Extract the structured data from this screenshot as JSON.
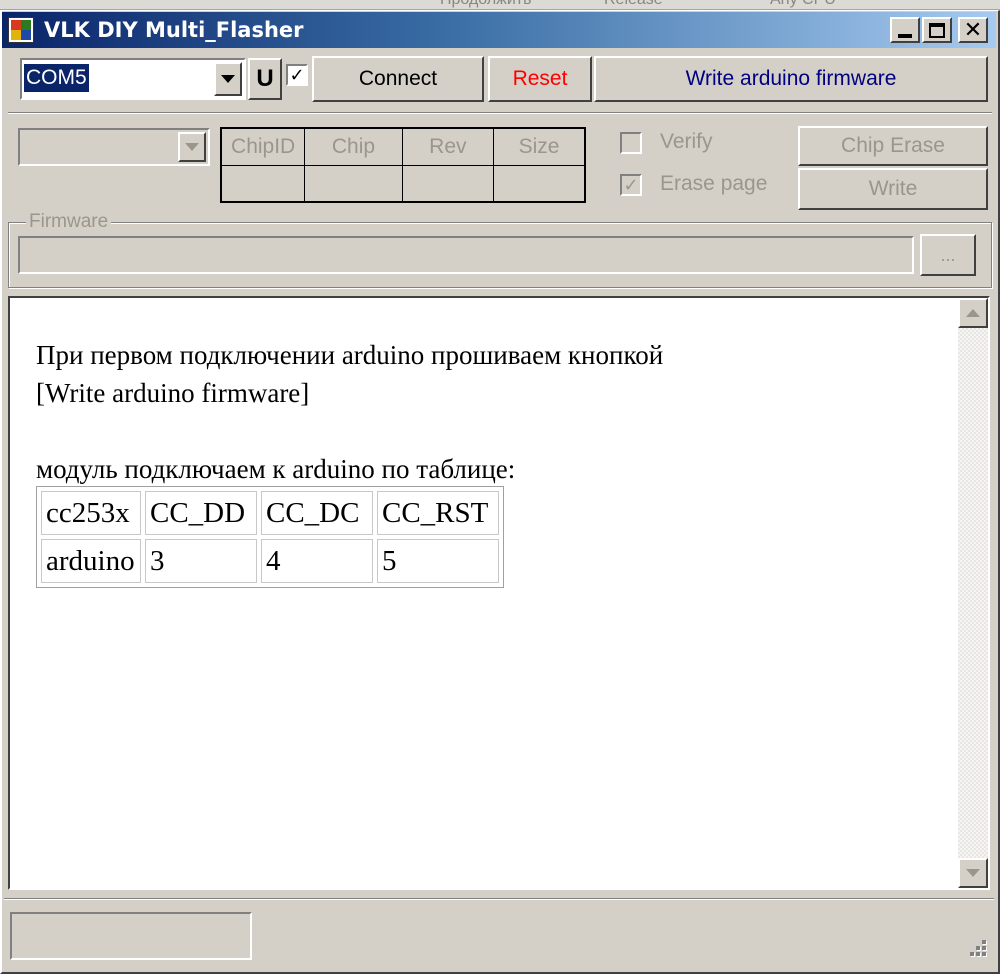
{
  "background_toolbar": {
    "item1": "Продолжить",
    "item2": "Release",
    "item3": "Any CPU"
  },
  "window": {
    "title": "VLK DIY Multi_Flasher",
    "colors": {
      "titlebar_start": "#0a246a",
      "titlebar_end": "#a6caf0",
      "face": "#d4d0c8"
    }
  },
  "connection": {
    "port_value": "COM5",
    "u_label": "U",
    "u_checkbox_checked": "✓",
    "connect_label": "Connect",
    "reset_label": "Reset",
    "reset_color": "#ff0000",
    "write_arduino_label": "Write arduino firmware",
    "write_arduino_color": "#000080"
  },
  "chip": {
    "headers": [
      "ChipID",
      "Chip",
      "Rev",
      "Size"
    ],
    "values": [
      "",
      "",
      "",
      ""
    ],
    "verify_label": "Verify",
    "verify_checked": "",
    "erase_page_label": "Erase page",
    "erase_page_checked": "✓",
    "chip_erase_label": "Chip Erase",
    "write_label": "Write"
  },
  "firmware": {
    "legend": "Firmware",
    "path_value": "",
    "browse_label": "..."
  },
  "content": {
    "line1": "При первом подключении arduino прошиваем кнопкой",
    "line2": "[Write arduino firmware]",
    "line3": "модуль подключаем к arduino по таблице:",
    "pin_table": {
      "header": [
        "cc253x",
        "CC_DD",
        "CC_DC",
        "CC_RST"
      ],
      "row": [
        "arduino",
        "3",
        "4",
        "5"
      ]
    }
  },
  "status": {
    "text": ""
  }
}
